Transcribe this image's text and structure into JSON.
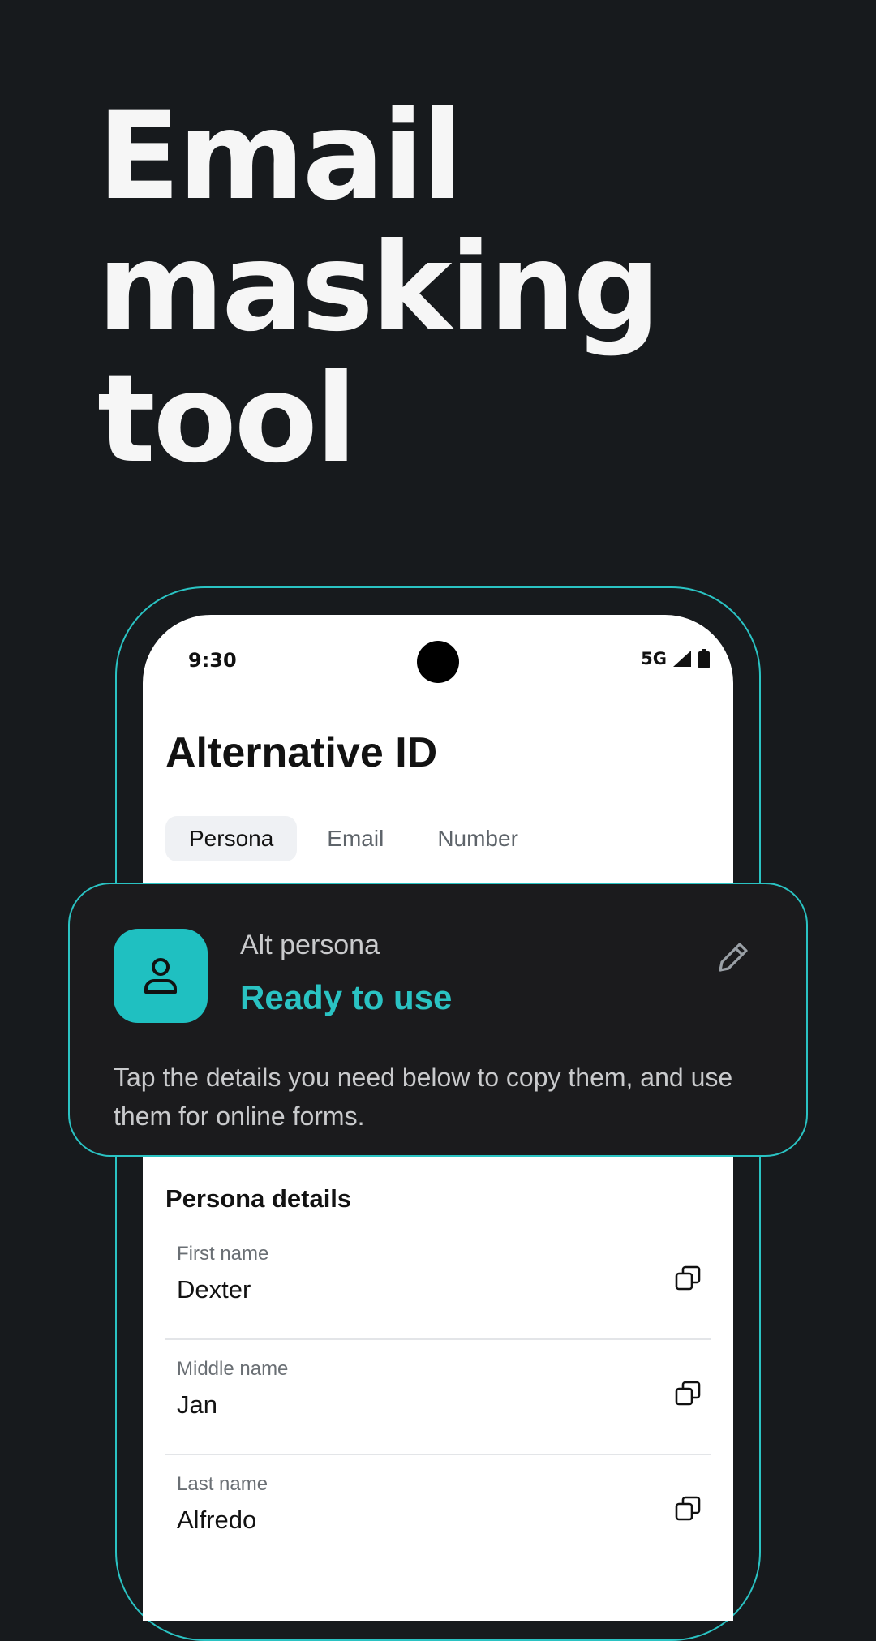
{
  "headline": [
    "Email",
    "masking",
    "tool"
  ],
  "status_bar": {
    "time": "9:30",
    "network": "5G"
  },
  "app": {
    "title": "Alternative ID",
    "tabs": [
      {
        "label": "Persona",
        "active": true
      },
      {
        "label": "Email",
        "active": false
      },
      {
        "label": "Number",
        "active": false
      }
    ]
  },
  "card": {
    "label": "Alt persona",
    "status": "Ready to use",
    "description": "Tap the details you need below to copy them, and use them for online forms.",
    "icons": {
      "avatar": "person-icon",
      "edit": "pencil-icon"
    }
  },
  "details": {
    "title": "Persona details",
    "rows": [
      {
        "label": "First name",
        "value": "Dexter"
      },
      {
        "label": "Middle name",
        "value": "Jan"
      },
      {
        "label": "Last name",
        "value": "Alfredo"
      }
    ],
    "copy_icon": "copy-icon"
  },
  "colors": {
    "background": "#171a1d",
    "accent": "#2ac3c3",
    "card": "#1b1b1d"
  }
}
